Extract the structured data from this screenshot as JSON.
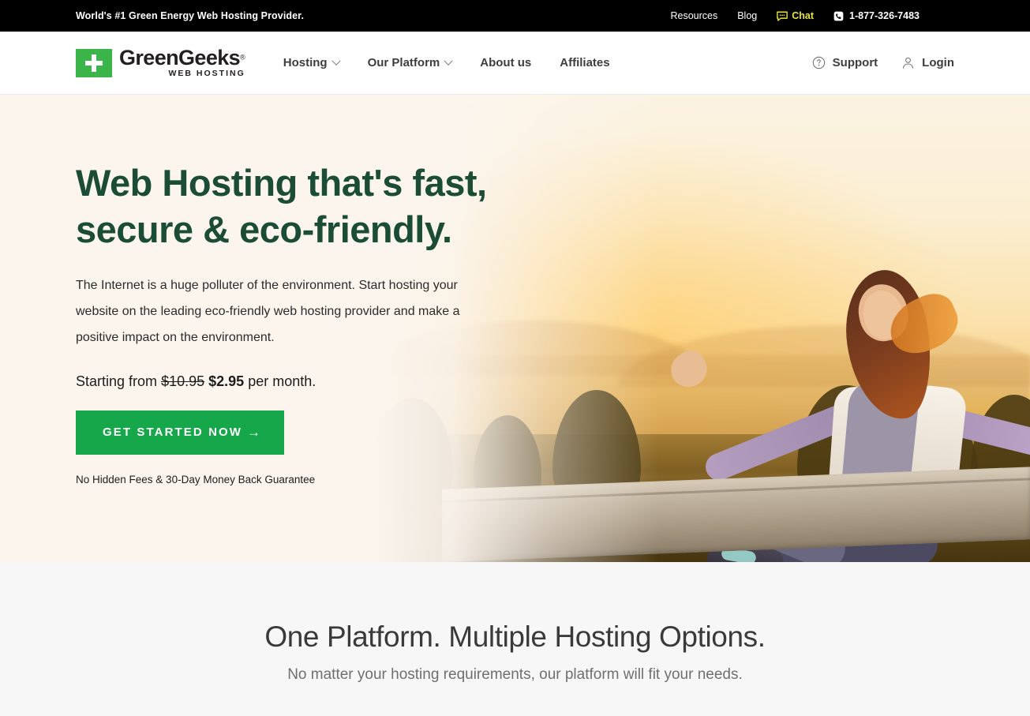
{
  "topbar": {
    "tagline": "World's #1 Green Energy Web Hosting Provider.",
    "resources_label": "Resources",
    "blog_label": "Blog",
    "chat_label": "Chat",
    "chat_icon": "chat-bubble-icon",
    "chat_color": "#e8e337",
    "phone_icon": "phone-icon",
    "phone_number": "1-877-326-7483",
    "background": "#000000"
  },
  "header": {
    "logo": {
      "mark_icon": "plus-icon",
      "mark_color": "#3bb54a",
      "name": "GreenGeeks",
      "registered": "®",
      "tagline": "WEB HOSTING"
    },
    "nav": [
      {
        "label": "Hosting",
        "has_dropdown": true
      },
      {
        "label": "Our Platform",
        "has_dropdown": true
      },
      {
        "label": "About us",
        "has_dropdown": false
      },
      {
        "label": "Affiliates",
        "has_dropdown": false
      }
    ],
    "support": {
      "label": "Support",
      "icon": "question-circle-icon"
    },
    "login": {
      "label": "Login",
      "icon": "user-icon"
    }
  },
  "hero": {
    "heading_line1": "Web Hosting that's fast,",
    "heading_line2": "secure & eco-friendly.",
    "heading_color": "#1b4d36",
    "paragraph": "The Internet is a huge polluter of the environment. Start hosting your website on the leading eco-friendly web hosting provider and make a positive impact on the environment.",
    "price_prefix": "Starting from",
    "price_old": "$10.95",
    "price_new": "$2.95",
    "price_suffix": "per month.",
    "cta_label": "GET STARTED NOW",
    "cta_arrow": "→",
    "cta_color": "#16a74b",
    "note": "No Hidden Fees & 30-Day Money Back Guarantee",
    "background_color": "#fbf5ee"
  },
  "section": {
    "title": "One Platform. Multiple Hosting Options.",
    "subtitle": "No matter your hosting requirements, our platform will fit your needs.",
    "background": "#f7f7f7"
  }
}
